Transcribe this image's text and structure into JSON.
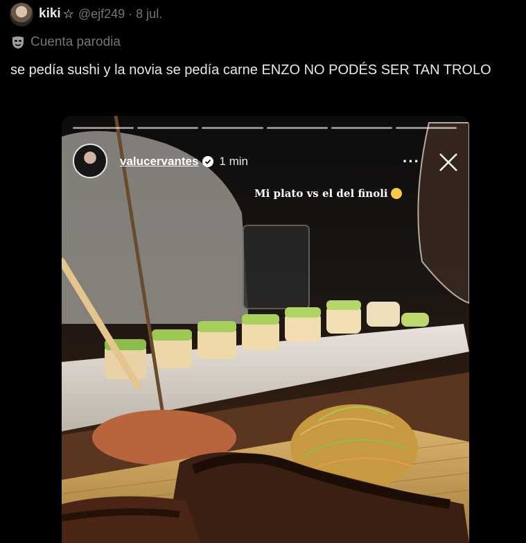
{
  "tweet": {
    "display_name": "kiki",
    "handle": "@ejf249",
    "separator": "·",
    "date": "8 jul.",
    "badge_label": "Cuenta parodia",
    "text": "se pedía sushi y la novia se pedía carne ENZO NO PODÉS SER TAN TROLO"
  },
  "story": {
    "username": "valucervantes",
    "time": "1 min",
    "caption": "Mi plato vs el del finoli",
    "progress_segments": 6,
    "more_label": "···"
  },
  "icons": {
    "star": "star-icon",
    "mask": "parody-mask-icon",
    "verified": "verified-icon",
    "close": "close-icon",
    "emoji": "laughing-emoji-icon"
  }
}
